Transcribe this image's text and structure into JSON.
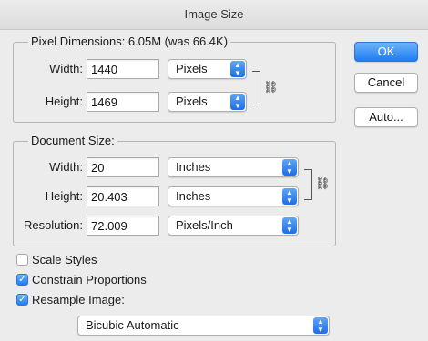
{
  "window": {
    "title": "Image Size"
  },
  "pixel_dimensions": {
    "title": "Pixel Dimensions:  6.05M (was 66.4K)",
    "width_label": "Width:",
    "width_value": "1440",
    "width_unit": "Pixels",
    "height_label": "Height:",
    "height_value": "1469",
    "height_unit": "Pixels"
  },
  "document_size": {
    "title": "Document Size:",
    "width_label": "Width:",
    "width_value": "20",
    "width_unit": "Inches",
    "height_label": "Height:",
    "height_value": "20.403",
    "height_unit": "Inches",
    "resolution_label": "Resolution:",
    "resolution_value": "72.009",
    "resolution_unit": "Pixels/Inch"
  },
  "buttons": {
    "ok": "OK",
    "cancel": "Cancel",
    "auto": "Auto..."
  },
  "options": {
    "scale_styles": {
      "label": "Scale Styles",
      "checked": false
    },
    "constrain_proportions": {
      "label": "Constrain Proportions",
      "checked": true
    },
    "resample_image": {
      "label": "Resample Image:",
      "checked": true
    },
    "resample_method": "Bicubic Automatic"
  },
  "icons": {
    "chain": "chain-link-icon",
    "dropdown": "updown-chevron-icon",
    "checkmark": "checkmark-icon"
  },
  "colors": {
    "accent": "#1f7cf1",
    "background": "#ececec"
  }
}
